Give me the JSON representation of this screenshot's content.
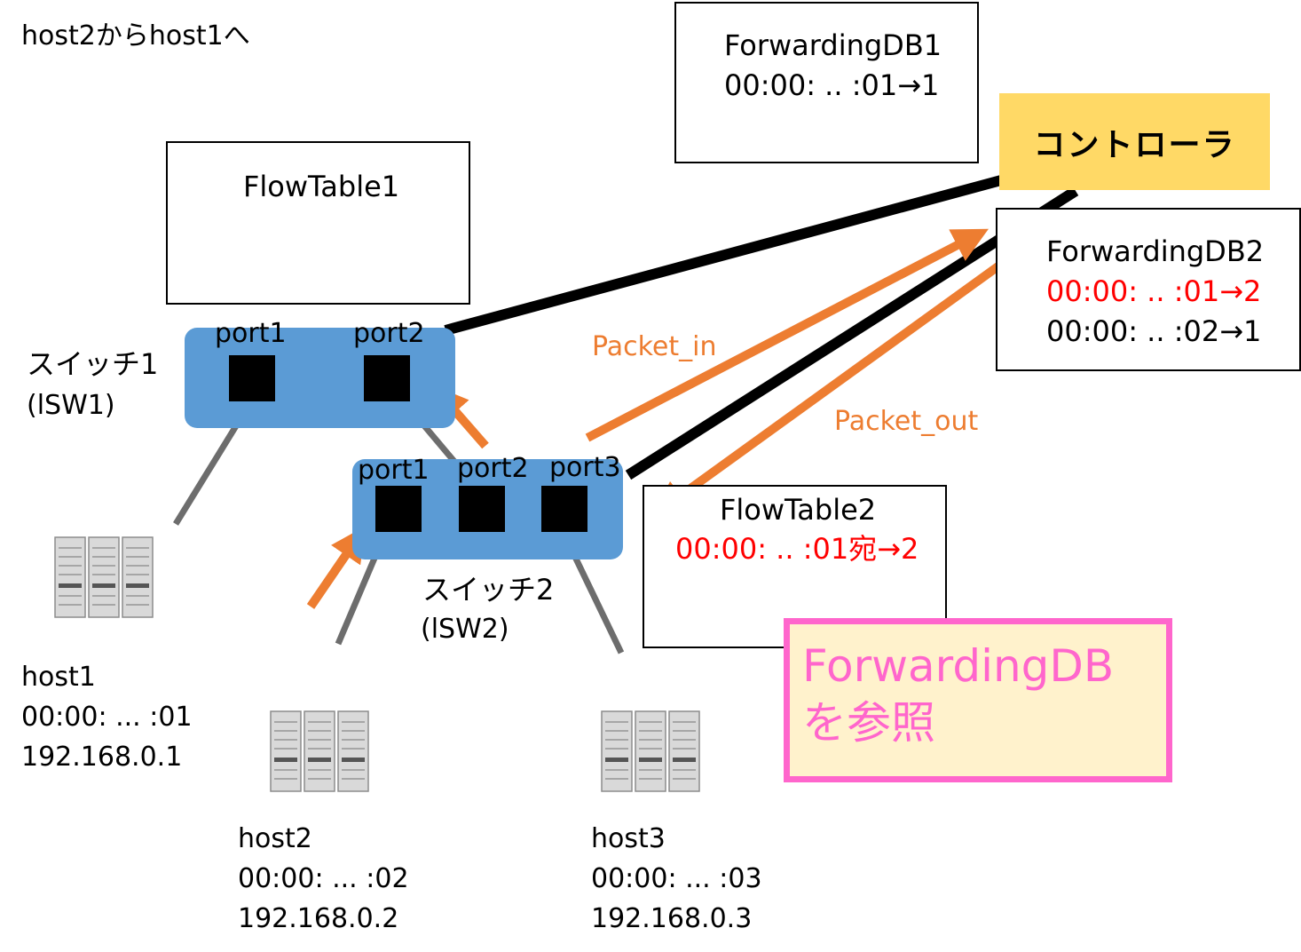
{
  "title": "host2からhost1へ",
  "forwarding_db1": {
    "title": "ForwardingDB1",
    "entries": [
      "00:00: .. :01→1"
    ]
  },
  "forwarding_db2": {
    "title": "ForwardingDB2",
    "entries": [
      "00:00: .. :01→2",
      "00:00: .. :02→1"
    ]
  },
  "flow_table1": {
    "title": "FlowTable1"
  },
  "flow_table2": {
    "title": "FlowTable2",
    "entries": [
      "00:00: .. :01宛→2"
    ]
  },
  "controller": {
    "label": "コントローラ"
  },
  "switch1": {
    "name": "スイッチ1",
    "id": "(lSW1)",
    "ports": [
      "port1",
      "port2"
    ]
  },
  "switch2": {
    "name": "スイッチ2",
    "id": "(lSW2)",
    "ports": [
      "port1",
      "port2",
      "port3"
    ]
  },
  "messages": {
    "packet_in": "Packet_in",
    "packet_out": "Packet_out"
  },
  "callout": {
    "line1": "ForwardingDB",
    "line2": "を参照"
  },
  "hosts": [
    {
      "name": "host1",
      "mac": "00:00: ... :01",
      "ip": "192.168.0.1",
      "icon": "server-icon"
    },
    {
      "name": "host2",
      "mac": "00:00: ... :02",
      "ip": "192.168.0.2",
      "icon": "server-icon"
    },
    {
      "name": "host3",
      "mac": "00:00: ... :03",
      "ip": "192.168.0.3",
      "icon": "server-icon"
    }
  ],
  "colors": {
    "switch": "#5b9bd5",
    "controller": "#ffd966",
    "arrow": "#ed7d31",
    "highlight": "#ff0000",
    "callout_border": "#ff66cc",
    "callout_fill": "#fff2cc",
    "host_link": "#6d6d6d"
  }
}
